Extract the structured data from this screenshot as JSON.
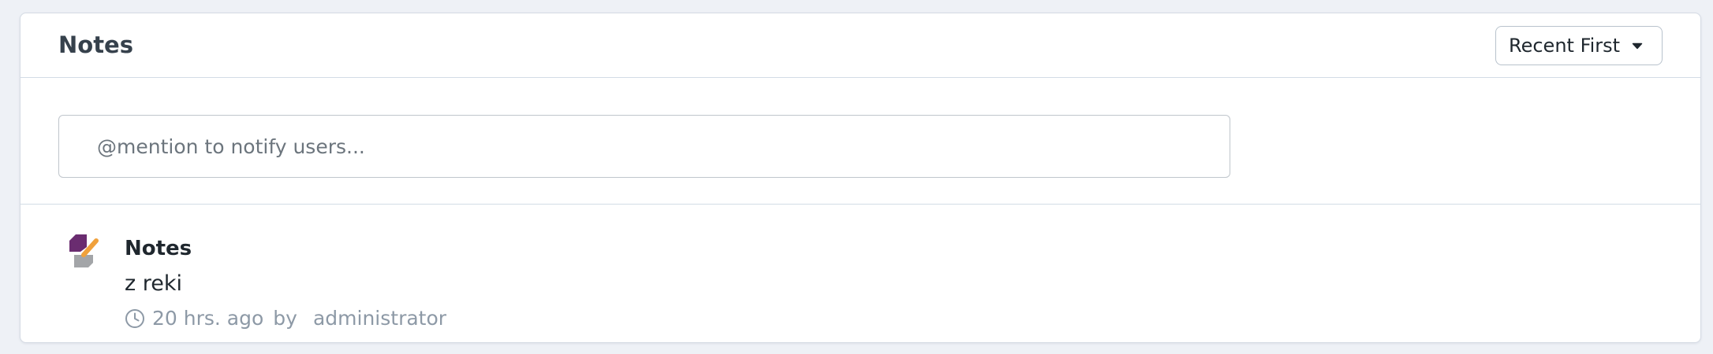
{
  "header": {
    "title": "Notes",
    "sort_label": "Recent First",
    "sort_icon": "caret-down-icon"
  },
  "comment": {
    "placeholder": "@mention to notify users..."
  },
  "timeline": {
    "items": [
      {
        "icon": "notes-icon",
        "title": "Notes",
        "content": "z reki",
        "time": "20 hrs. ago",
        "by_label": "by",
        "user": "administrator"
      }
    ]
  },
  "colors": {
    "icon_purple": "#6a2c70",
    "icon_orange": "#f0a13c",
    "icon_gray": "#a3a5a8",
    "muted_text": "#8d99a6"
  }
}
